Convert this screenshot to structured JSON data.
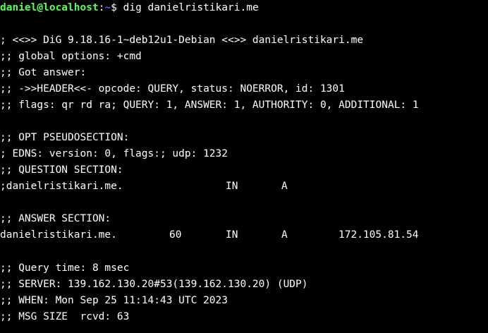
{
  "colors": {
    "background": "#000000",
    "foreground": "#ffffff",
    "prompt_user_host": "#55ff55",
    "prompt_path": "#5555ff"
  },
  "prompt": {
    "user_host": "daniel@localhost",
    "separator": ":",
    "path": "~",
    "symbol": "$",
    "command": "dig danielristikari.me"
  },
  "header_lines": [
    "; <<>> DiG 9.18.16-1~deb12u1-Debian <<>> danielristikari.me",
    ";; global options: +cmd",
    ";; Got answer:",
    ";; ->>HEADER<<- opcode: QUERY, status: NOERROR, id: 1301",
    ";; flags: qr rd ra; QUERY: 1, ANSWER: 1, AUTHORITY: 0, ADDITIONAL: 1"
  ],
  "opt_section": {
    "title": ";; OPT PSEUDOSECTION:",
    "edns": "; EDNS: version: 0, flags:; udp: 1232"
  },
  "question_section": {
    "title": ";; QUESTION SECTION:",
    "name": ";danielristikari.me.",
    "class": "IN",
    "type": "A"
  },
  "answer_section": {
    "title": ";; ANSWER SECTION:",
    "name": "danielristikari.me.",
    "ttl": "60",
    "class": "IN",
    "type": "A",
    "address": "172.105.81.54"
  },
  "footer_lines": [
    ";; Query time: 8 msec",
    ";; SERVER: 139.162.130.20#53(139.162.130.20) (UDP)",
    ";; WHEN: Mon Sep 25 11:14:43 UTC 2023",
    ";; MSG SIZE  rcvd: 63"
  ]
}
